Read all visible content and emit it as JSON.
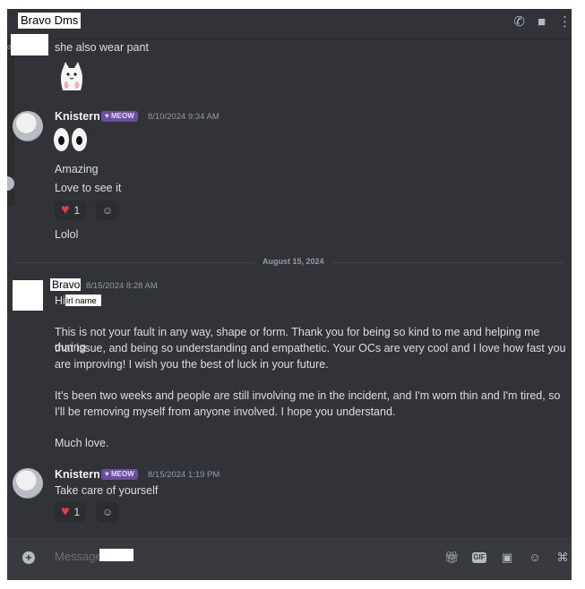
{
  "header": {
    "channel_name": "Bravo Dms",
    "call_icon": "phone-icon",
    "video_icon": "video-icon"
  },
  "side": {
    "hint": "dir"
  },
  "date_divider": "August 15, 2024",
  "messages": [
    {
      "text": "she also wear pant"
    },
    {
      "username": "Knistern",
      "badge": "MEOW",
      "timestamp": "8/10/2024 9:34 AM",
      "lines": [
        "Amazing",
        "Love to see it"
      ],
      "reaction_count": "1",
      "followup": "Lolol"
    },
    {
      "username": "Bravo",
      "timestamp": "8/15/2024 8:28 AM",
      "greeting": "Hi",
      "redacted_label": "irl name",
      "para1_l1": "This is not your fault in any way, shape or form. Thank you for being so kind to me and helping me during",
      "para1_l2": "that issue, and being so understanding and empathetic. Your OCs are very cool and I love how fast you",
      "para1_l3": "are improving! I wish you the best of luck in your future.",
      "para2_l1": "It's been two weeks and people are still involving me in the incident, and I'm worn thin and I'm tired, so",
      "para2_l2": "I'll be removing myself from anyone involved. I hope you understand.",
      "signoff": "Much love."
    },
    {
      "username": "Knistern",
      "badge": "MEOW",
      "timestamp": "8/15/2024 1:19 PM",
      "text": "Take care of yourself",
      "reaction_count": "1"
    }
  ],
  "composer": {
    "placeholder": "Message",
    "icons": [
      "gift-icon",
      "gif-icon",
      "sticker-icon",
      "emoji-icon",
      "gamepad-icon"
    ],
    "gif_label": "GIF"
  }
}
